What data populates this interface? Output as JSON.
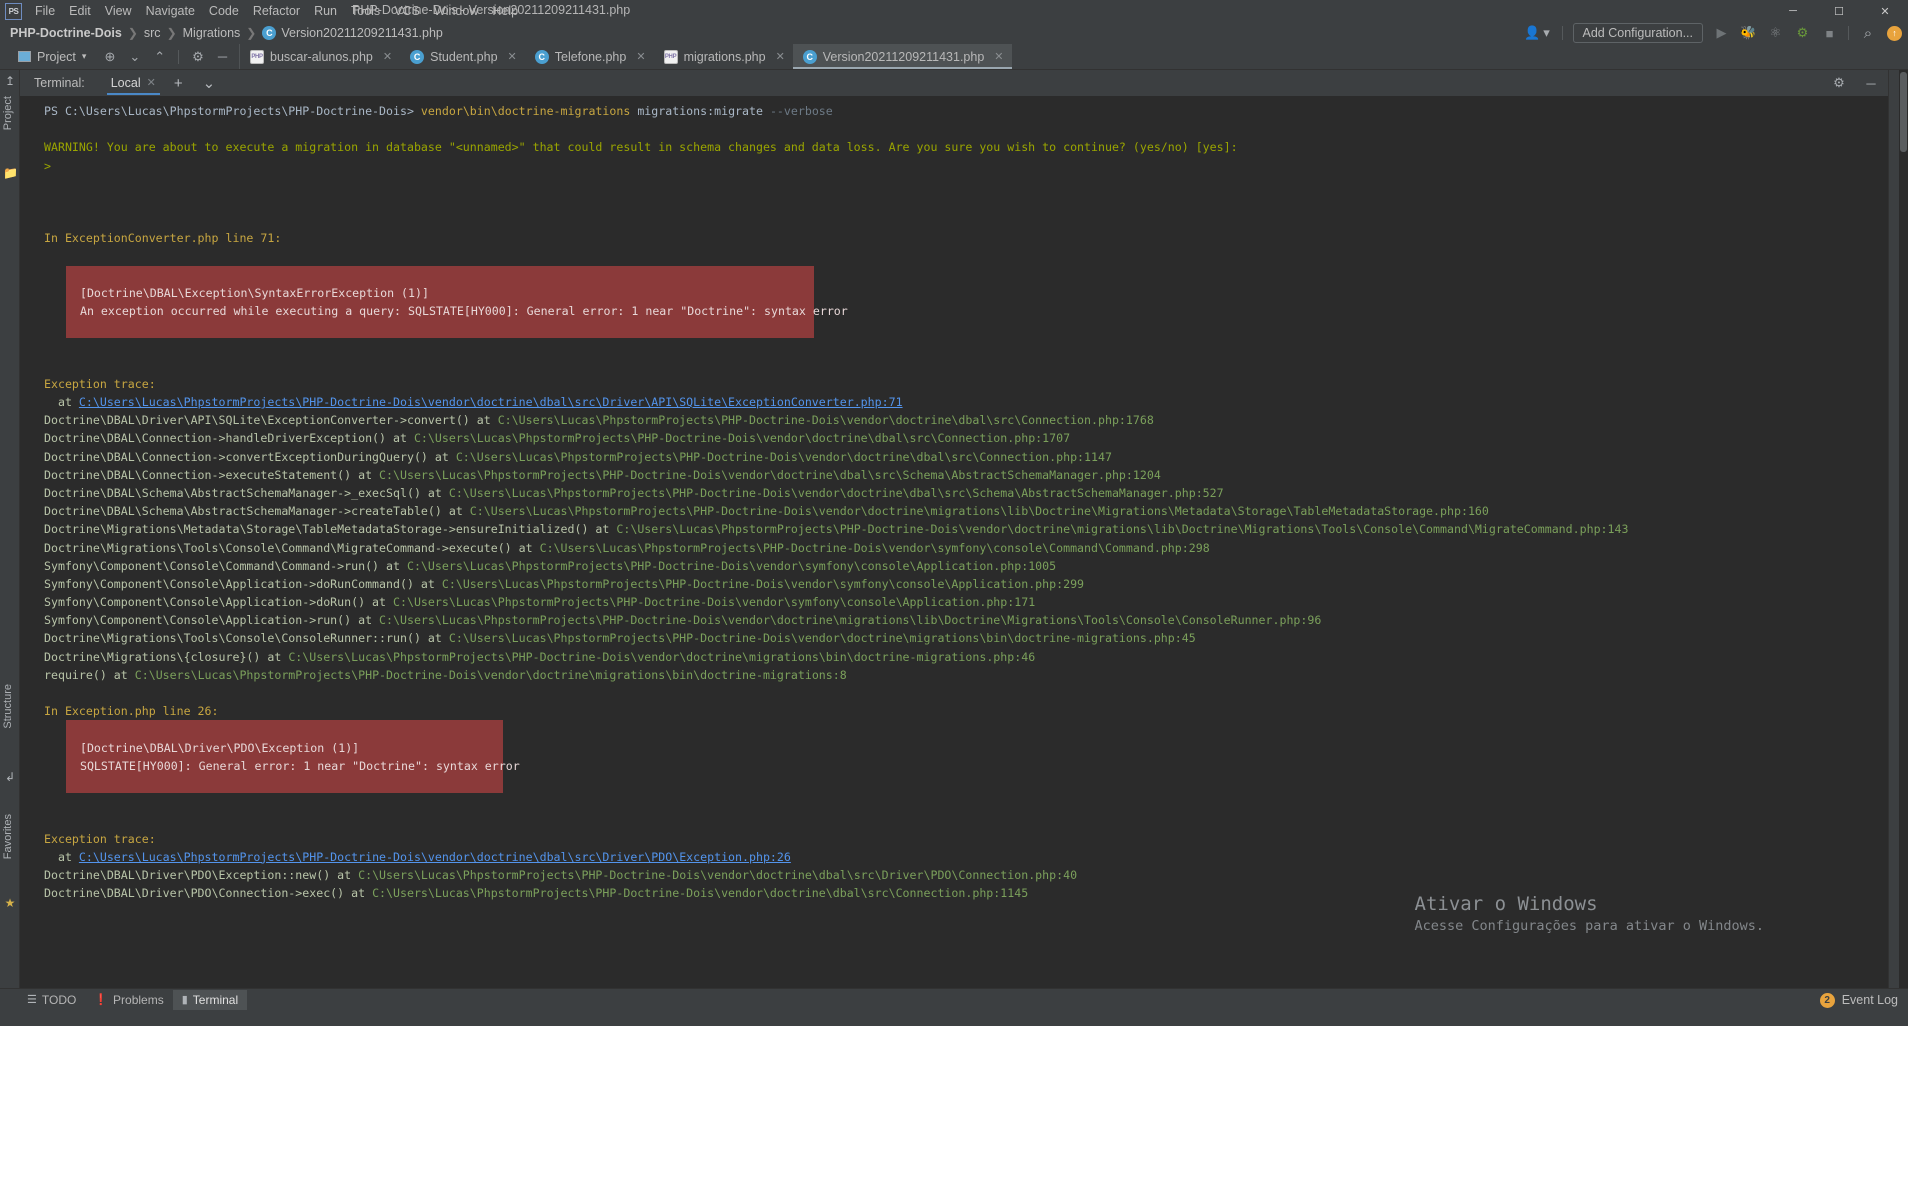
{
  "window": {
    "app_icon": "PS",
    "title": "PHP-Doctrine-Dois - Version20211209211431.php",
    "minimize": "─",
    "maximize": "☐",
    "close": "✕"
  },
  "menu": {
    "items": [
      {
        "label": "File"
      },
      {
        "label": "Edit"
      },
      {
        "label": "View"
      },
      {
        "label": "Navigate"
      },
      {
        "label": "Code"
      },
      {
        "label": "Refactor"
      },
      {
        "label": "Run"
      },
      {
        "label": "Tools"
      },
      {
        "label": "VCS"
      },
      {
        "label": "Window"
      },
      {
        "label": "Help"
      }
    ]
  },
  "breadcrumb": {
    "separator": "❯",
    "items": [
      "PHP-Doctrine-Dois",
      "src",
      "Migrations",
      "Version20211209211431.php"
    ],
    "file_icon": "class-icon"
  },
  "navbar_right": {
    "profile_icon": "user-profile-icon",
    "profile_caret": "▾",
    "add_configuration": "Add Configuration...",
    "run_icon": "▶",
    "debug_icon": "debug-bug-icon",
    "coverage_icon": "run-with-coverage-icon",
    "profiler_icon": "profiler-icon",
    "stop_icon": "■",
    "search_icon": "⌕",
    "updates_icon": "⬆"
  },
  "toolbar": {
    "project_label": "Project",
    "project_caret": "▾",
    "locate_icon": "⊕",
    "expand_icon": "≡",
    "collapse_icon": "≡",
    "settings_icon": "⚙",
    "hide_icon": "─"
  },
  "editor_tabs": [
    {
      "label": "buscar-alunos.php",
      "icon": "php-file-icon",
      "icon_text": "PHP",
      "active": false,
      "close": "✕"
    },
    {
      "label": "Student.php",
      "icon": "php-class-icon",
      "icon_text": "C",
      "active": false,
      "close": "✕"
    },
    {
      "label": "Telefone.php",
      "icon": "php-class-icon",
      "icon_text": "C",
      "active": false,
      "close": "✕"
    },
    {
      "label": "migrations.php",
      "icon": "php-file-icon",
      "icon_text": "PHP",
      "active": false,
      "close": "✕"
    },
    {
      "label": "Version20211209211431.php",
      "icon": "php-class-icon",
      "icon_text": "C",
      "active": true,
      "close": "✕"
    }
  ],
  "left_rail": {
    "project_tab": "Project",
    "structure_tab": "Structure",
    "favorites_tab": "Favorites",
    "folder_icon": "folder-icon",
    "star_icon": "★",
    "pin_icon": "↥"
  },
  "terminal_header": {
    "label": "Terminal:",
    "tab_label": "Local",
    "tab_close": "✕",
    "new_tab": "+",
    "tab_list": "⌄",
    "settings_icon": "⚙",
    "hide_icon": "─"
  },
  "terminal": {
    "prompt_path": "PS C:\\Users\\Lucas\\PhpstormProjects\\PHP-Doctrine-Dois>",
    "command": " vendor\\bin\\doctrine-migrations",
    "command_arg": " migrations:migrate",
    "command_flag": " --verbose",
    "warning": "WARNING! You are about to execute a migration in database \"<unnamed>\" that could result in schema changes and data loss. Are you sure you wish to continue? (yes/no) [yes]:",
    "answer_prompt": ">",
    "exception1_header": "In ExceptionConverter.php line 71:",
    "exception1_box": [
      "",
      "  [Doctrine\\DBAL\\Exception\\SyntaxErrorException (1)]",
      "  An exception occurred while executing a query: SQLSTATE[HY000]: General error: 1 near \"Doctrine\": syntax error",
      ""
    ],
    "trace1_label": "Exception trace:",
    "trace1_first_at": "  at ",
    "trace1_first_link": "C:\\Users\\Lucas\\PhpstormProjects\\PHP-Doctrine-Dois\\vendor\\doctrine\\dbal\\src\\Driver\\API\\SQLite\\ExceptionConverter.php:71",
    "trace1": [
      {
        "call": "Doctrine\\DBAL\\Driver\\API\\SQLite\\ExceptionConverter->convert() at ",
        "path": "C:\\Users\\Lucas\\PhpstormProjects\\PHP-Doctrine-Dois\\vendor\\doctrine\\dbal\\src\\Connection.php:1768"
      },
      {
        "call": "Doctrine\\DBAL\\Connection->handleDriverException() at ",
        "path": "C:\\Users\\Lucas\\PhpstormProjects\\PHP-Doctrine-Dois\\vendor\\doctrine\\dbal\\src\\Connection.php:1707"
      },
      {
        "call": "Doctrine\\DBAL\\Connection->convertExceptionDuringQuery() at ",
        "path": "C:\\Users\\Lucas\\PhpstormProjects\\PHP-Doctrine-Dois\\vendor\\doctrine\\dbal\\src\\Connection.php:1147"
      },
      {
        "call": "Doctrine\\DBAL\\Connection->executeStatement() at ",
        "path": "C:\\Users\\Lucas\\PhpstormProjects\\PHP-Doctrine-Dois\\vendor\\doctrine\\dbal\\src\\Schema\\AbstractSchemaManager.php:1204"
      },
      {
        "call": "Doctrine\\DBAL\\Schema\\AbstractSchemaManager->_execSql() at ",
        "path": "C:\\Users\\Lucas\\PhpstormProjects\\PHP-Doctrine-Dois\\vendor\\doctrine\\dbal\\src\\Schema\\AbstractSchemaManager.php:527"
      },
      {
        "call": "Doctrine\\DBAL\\Schema\\AbstractSchemaManager->createTable() at ",
        "path": "C:\\Users\\Lucas\\PhpstormProjects\\PHP-Doctrine-Dois\\vendor\\doctrine\\migrations\\lib\\Doctrine\\Migrations\\Metadata\\Storage\\TableMetadataStorage.php:160"
      },
      {
        "call": "Doctrine\\Migrations\\Metadata\\Storage\\TableMetadataStorage->ensureInitialized() at ",
        "path": "C:\\Users\\Lucas\\PhpstormProjects\\PHP-Doctrine-Dois\\vendor\\doctrine\\migrations\\lib\\Doctrine\\Migrations\\Tools\\Console\\Command\\MigrateCommand.php:143"
      },
      {
        "call": "Doctrine\\Migrations\\Tools\\Console\\Command\\MigrateCommand->execute() at ",
        "path": "C:\\Users\\Lucas\\PhpstormProjects\\PHP-Doctrine-Dois\\vendor\\symfony\\console\\Command\\Command.php:298"
      },
      {
        "call": "Symfony\\Component\\Console\\Command\\Command->run() at ",
        "path": "C:\\Users\\Lucas\\PhpstormProjects\\PHP-Doctrine-Dois\\vendor\\symfony\\console\\Application.php:1005"
      },
      {
        "call": "Symfony\\Component\\Console\\Application->doRunCommand() at ",
        "path": "C:\\Users\\Lucas\\PhpstormProjects\\PHP-Doctrine-Dois\\vendor\\symfony\\console\\Application.php:299"
      },
      {
        "call": "Symfony\\Component\\Console\\Application->doRun() at ",
        "path": "C:\\Users\\Lucas\\PhpstormProjects\\PHP-Doctrine-Dois\\vendor\\symfony\\console\\Application.php:171"
      },
      {
        "call": "Symfony\\Component\\Console\\Application->run() at ",
        "path": "C:\\Users\\Lucas\\PhpstormProjects\\PHP-Doctrine-Dois\\vendor\\doctrine\\migrations\\lib\\Doctrine\\Migrations\\Tools\\Console\\ConsoleRunner.php:96"
      },
      {
        "call": "Doctrine\\Migrations\\Tools\\Console\\ConsoleRunner::run() at ",
        "path": "C:\\Users\\Lucas\\PhpstormProjects\\PHP-Doctrine-Dois\\vendor\\doctrine\\migrations\\bin\\doctrine-migrations.php:45"
      },
      {
        "call": "Doctrine\\Migrations\\{closure}() at ",
        "path": "C:\\Users\\Lucas\\PhpstormProjects\\PHP-Doctrine-Dois\\vendor\\doctrine\\migrations\\bin\\doctrine-migrations.php:46"
      },
      {
        "call": "require() at ",
        "path": "C:\\Users\\Lucas\\PhpstormProjects\\PHP-Doctrine-Dois\\vendor\\doctrine\\migrations\\bin\\doctrine-migrations:8"
      }
    ],
    "exception2_header": "In Exception.php line 26:",
    "exception2_box": [
      "",
      "  [Doctrine\\DBAL\\Driver\\PDO\\Exception (1)]",
      "  SQLSTATE[HY000]: General error: 1 near \"Doctrine\": syntax error",
      ""
    ],
    "trace2_label": "Exception trace:",
    "trace2_first_at": "  at ",
    "trace2_first_link": "C:\\Users\\Lucas\\PhpstormProjects\\PHP-Doctrine-Dois\\vendor\\doctrine\\dbal\\src\\Driver\\PDO\\Exception.php:26",
    "trace2": [
      {
        "call": "Doctrine\\DBAL\\Driver\\PDO\\Exception::new() at ",
        "path": "C:\\Users\\Lucas\\PhpstormProjects\\PHP-Doctrine-Dois\\vendor\\doctrine\\dbal\\src\\Driver\\PDO\\Connection.php:40"
      },
      {
        "call": "Doctrine\\DBAL\\Driver\\PDO\\Connection->exec() at ",
        "path": "C:\\Users\\Lucas\\PhpstormProjects\\PHP-Doctrine-Dois\\vendor\\doctrine\\dbal\\src\\Connection.php:1145"
      }
    ]
  },
  "watermark": {
    "title": "Ativar o Windows",
    "subtitle": "Acesse Configurações para ativar o Windows."
  },
  "statusbar": {
    "todo": "TODO",
    "todo_icon": "list-icon",
    "problems": "Problems",
    "problems_icon": "warning-icon",
    "terminal": "Terminal",
    "terminal_icon": "console-icon",
    "event_log": "Event Log",
    "event_log_count": "2"
  },
  "colors": {
    "ide_bg": "#3c3f41",
    "console_bg": "#2b2b2b",
    "error_bg": "#8b3a3a",
    "accent_blue": "#4a88c7",
    "link_blue": "#5394ec",
    "path_green": "#6a8759",
    "warn_yellow": "#c7a641"
  }
}
